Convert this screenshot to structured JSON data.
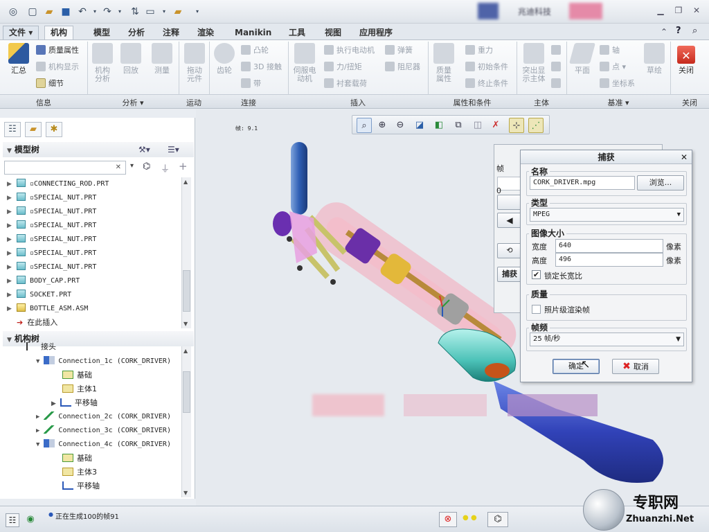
{
  "titlebar": {
    "app_title": "兆迪科技"
  },
  "tabs": [
    "文件",
    "机构",
    "模型",
    "分析",
    "注释",
    "渲染",
    "Manikin",
    "工具",
    "视图",
    "应用程序"
  ],
  "ribbon": {
    "info": {
      "summary": "汇总",
      "mass_props": "质量属性",
      "mech_display": "机构显示",
      "detail": "细节",
      "group": "信息"
    },
    "analysis": {
      "mech_analysis": "机构\n分析",
      "playback": "回放",
      "measure": "测量",
      "group": "分析"
    },
    "motion": {
      "drag": "拖动\n元件",
      "group": "运动"
    },
    "connect": {
      "gear": "齿轮",
      "cam": "凸轮",
      "contact3d": "3D 接触",
      "belt": "带",
      "group": "连接"
    },
    "insert": {
      "servo": "伺服电\n动机",
      "exec_motor": "执行电动机",
      "force_torque": "力/扭矩",
      "bushing": "衬套载荷",
      "spring": "弹簧",
      "damper": "阻尼器",
      "group": "插入"
    },
    "props": {
      "mass": "质量\n属性",
      "gravity": "重力",
      "init_cond": "初始条件",
      "term_cond": "终止条件",
      "group": "属性和条件"
    },
    "body": {
      "highlight": "突出显\n示主体",
      "group": "主体"
    },
    "datum": {
      "plane": "平面",
      "axis": "轴",
      "point": "点",
      "csys": "坐标系",
      "sketch": "草绘",
      "group": "基准"
    },
    "close": {
      "close": "关闭",
      "group": "关闭"
    }
  },
  "model_tree": {
    "title": "模型树",
    "items": [
      "CONNECTING_ROD.PRT",
      "SPECIAL_NUT.PRT",
      "SPECIAL_NUT.PRT",
      "SPECIAL_NUT.PRT",
      "SPECIAL_NUT.PRT",
      "SPECIAL_NUT.PRT",
      "SPECIAL_NUT.PRT",
      "BODY_CAP.PRT",
      "SOCKET.PRT",
      "BOTTLE_ASM.ASM"
    ],
    "insert_here": "在此插入"
  },
  "mech_tree": {
    "title": "机构树",
    "rows": [
      {
        "label": "接头",
        "indent": 0
      },
      {
        "label": "Connection_1c  (CORK_DRIVER)",
        "indent": 1
      },
      {
        "label": "基础",
        "indent": 2
      },
      {
        "label": "主体1",
        "indent": 2
      },
      {
        "label": "平移轴",
        "indent": 2
      },
      {
        "label": "Connection_2c  (CORK_DRIVER)",
        "indent": 1
      },
      {
        "label": "Connection_3c  (CORK_DRIVER)",
        "indent": 1
      },
      {
        "label": "Connection_4c  (CORK_DRIVER)",
        "indent": 1
      },
      {
        "label": "基础",
        "indent": 2
      },
      {
        "label": "主体3",
        "indent": 2
      },
      {
        "label": "平移轴",
        "indent": 2
      }
    ]
  },
  "viewport": {
    "frame_label": "帧: 9.1"
  },
  "dialog": {
    "title": "捕获",
    "name_section": "名称",
    "filename": "CORK_DRIVER.mpg",
    "browse": "浏览...",
    "type_section": "类型",
    "type_value": "MPEG",
    "size_section": "图像大小",
    "width_label": "宽度",
    "width_value": "640",
    "height_label": "高度",
    "height_value": "496",
    "unit": "像素",
    "lock_ratio": "锁定长宽比",
    "quality_section": "质量",
    "photo_render": "照片级渲染帧",
    "fps_section": "帧频",
    "fps_value": "25 帧/秒",
    "ok": "确定",
    "cancel": "取消"
  },
  "back_dialog": {
    "frame": "帧",
    "zero": "0",
    "capture": "捕获"
  },
  "status": {
    "message": "正在生成100的帧91"
  },
  "watermark": {
    "cn": "专职网",
    "en": "Zhuanzhi.Net"
  }
}
